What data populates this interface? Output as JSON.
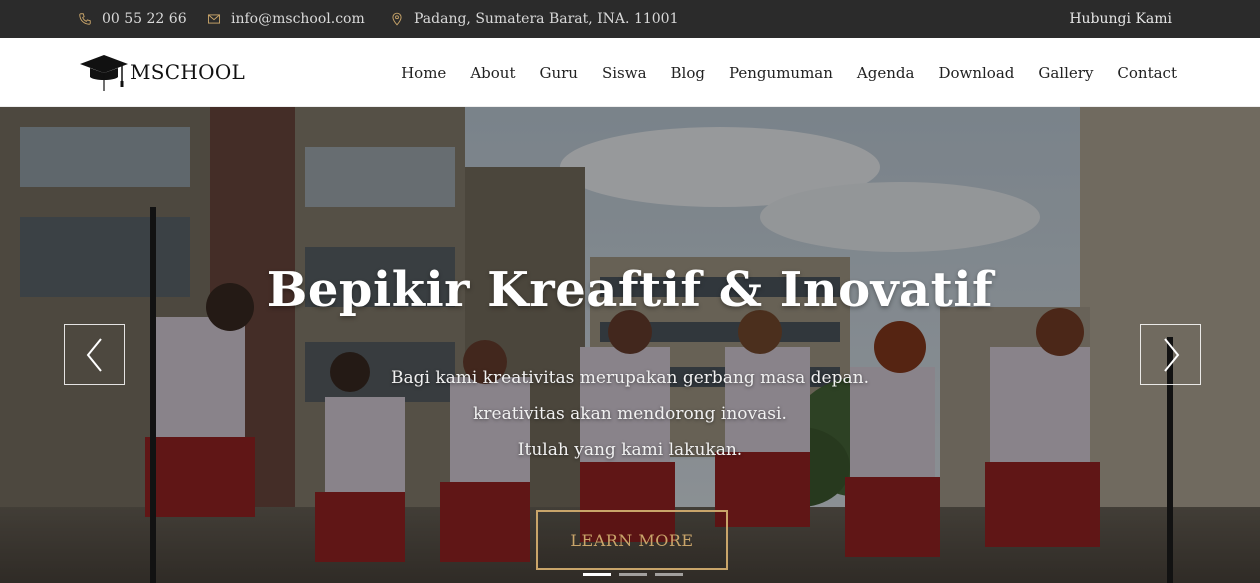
{
  "topbar": {
    "phone": "00 55 22 66",
    "email": "info@mschool.com",
    "address": "Padang, Sumatera Barat, INA. 11001",
    "contact_link": "Hubungi Kami"
  },
  "brand": {
    "name": "MSCHOOL"
  },
  "nav": {
    "items": [
      "Home",
      "About",
      "Guru",
      "Siswa",
      "Blog",
      "Pengumuman",
      "Agenda",
      "Download",
      "Gallery",
      "Contact"
    ]
  },
  "hero": {
    "title": "Bepikir Kreaftif & Inovatif",
    "lines": [
      "Bagi kami kreativitas merupakan gerbang masa depan.",
      "kreativitas akan mendorong inovasi.",
      "Itulah yang kami lakukan."
    ],
    "cta_label": "LEARN MORE",
    "slide_count": 3,
    "active_slide": 1
  },
  "colors": {
    "topbar_bg": "#2b2b2b",
    "accent_gold": "#c9a56a",
    "nav_bg": "#ffffff"
  },
  "icons": {
    "phone": "phone-icon",
    "email": "envelope-icon",
    "address": "map-pin-icon",
    "logo": "graduation-cap-icon",
    "prev": "chevron-left-icon",
    "next": "chevron-right-icon"
  }
}
